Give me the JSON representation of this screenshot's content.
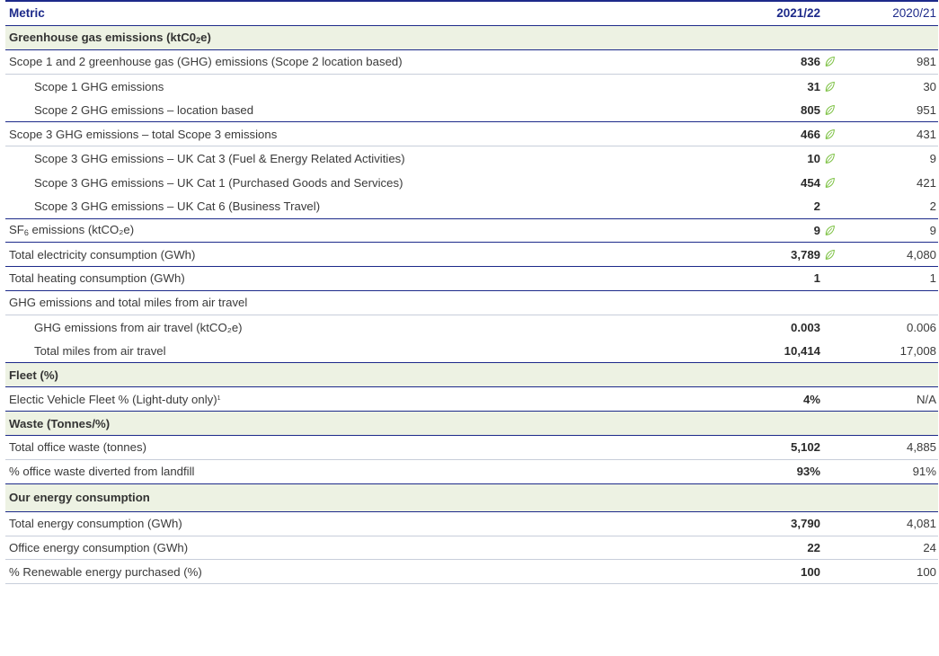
{
  "header": {
    "metric": "Metric",
    "current": "2021/22",
    "previous": "2020/21"
  },
  "sections": {
    "ghg": {
      "pre": "Greenhouse gas emissions (ktC0",
      "sub": "2",
      "post": "e)"
    },
    "fleet": "Fleet (%)",
    "waste": "Waste (Tonnes/%)",
    "energy": "Our energy consumption"
  },
  "rows": {
    "r1": {
      "label": "Scope 1 and 2 greenhouse gas (GHG) emissions (Scope 2 location based)",
      "current": "836",
      "previous": "981"
    },
    "r2": {
      "label": "Scope 1 GHG emissions",
      "current": "31",
      "previous": "30"
    },
    "r3": {
      "label": "Scope 2 GHG emissions – location based",
      "current": "805",
      "previous": "951"
    },
    "r4": {
      "label": "Scope 3 GHG emissions – total Scope 3 emissions",
      "current": "466",
      "previous": "431"
    },
    "r5": {
      "label": "Scope 3 GHG emissions – UK Cat 3 (Fuel & Energy Related Activities)",
      "current": "10",
      "previous": "9"
    },
    "r6": {
      "label": "Scope 3 GHG emissions – UK Cat 1 (Purchased Goods and Services)",
      "current": "454",
      "previous": "421"
    },
    "r7": {
      "label": "Scope 3 GHG emissions – UK Cat 6  (Business Travel)",
      "current": "2",
      "previous": "2"
    },
    "r8": {
      "pre": "SF",
      "sub": "6",
      "post": " emissions (ktCO₂e)",
      "current": "9",
      "previous": "9"
    },
    "r9": {
      "label": "Total electricity consumption (GWh)",
      "current": "3,789",
      "previous": "4,080"
    },
    "r10": {
      "label": "Total heating consumption (GWh)",
      "current": "1",
      "previous": "1"
    },
    "r11": {
      "label": "GHG emissions and total miles from air travel"
    },
    "r12": {
      "label": "GHG emissions from air travel (ktCO₂e)",
      "current": "0.003",
      "previous": "0.006"
    },
    "r13": {
      "label": "Total miles from air travel",
      "current": "10,414",
      "previous": "17,008"
    },
    "r14": {
      "label": "Electic Vehicle Fleet % (Light-duty only)",
      "sup": "1",
      "current": "4%",
      "previous": "N/A"
    },
    "r15": {
      "label": "Total office waste (tonnes)",
      "current": "5,102",
      "previous": "4,885"
    },
    "r16": {
      "label": "% office waste diverted from landfill",
      "current": "93%",
      "previous": "91%"
    },
    "r17": {
      "label": "Total energy consumption (GWh)",
      "current": "3,790",
      "previous": "4,081"
    },
    "r18": {
      "label": "Office energy consumption (GWh)",
      "current": "22",
      "previous": "24"
    },
    "r19": {
      "label": "% Renewable energy purchased (%)",
      "current": "100",
      "previous": "100"
    }
  },
  "icons": {
    "assured": "leaf-icon"
  },
  "colors": {
    "header_navy": "#1d2a8a",
    "section_bg": "#edf2e3",
    "leaf_green": "#7cc142"
  }
}
